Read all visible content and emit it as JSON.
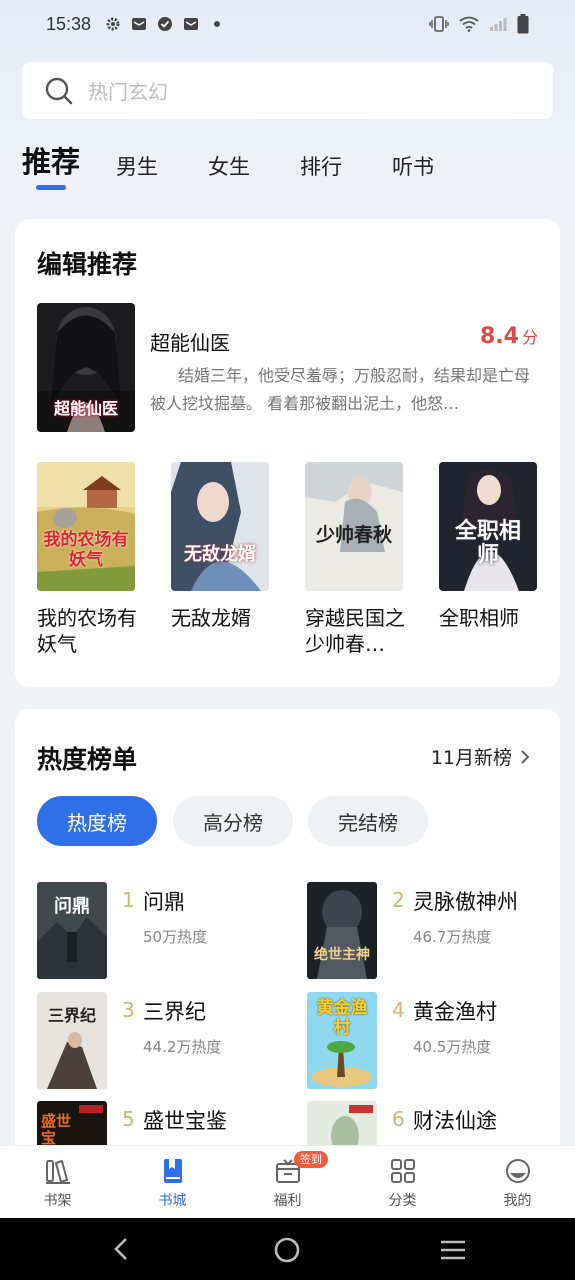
{
  "status_bar": {
    "time": "15:38"
  },
  "search": {
    "placeholder": "热门玄幻"
  },
  "tabs": [
    {
      "label": "推荐",
      "active": true
    },
    {
      "label": "男生"
    },
    {
      "label": "女生"
    },
    {
      "label": "排行"
    },
    {
      "label": "听书"
    }
  ],
  "editor_pick": {
    "title": "编辑推荐",
    "featured": {
      "title": "超能仙医",
      "score": "8.4",
      "score_unit": "分",
      "description": "结婚三年，他受尽羞辱；万般忍耐，结果却是亡母被人挖坟掘墓。 看着那被翻出泥土，他怒…",
      "cover_text": "超能仙医"
    },
    "books": [
      {
        "title": "我的农场有妖气",
        "cover_text": "我的农场有妖气"
      },
      {
        "title": "无敌龙婿",
        "cover_text": "无敌龙婿"
      },
      {
        "title": "穿越民国之少帅春…",
        "cover_text": "少帅春秋"
      },
      {
        "title": "全职相师",
        "cover_text": "全职相师"
      }
    ]
  },
  "hot_list": {
    "title": "热度榜单",
    "more_label": "11月新榜",
    "filters": [
      {
        "label": "热度榜",
        "active": true
      },
      {
        "label": "高分榜"
      },
      {
        "label": "完结榜"
      }
    ],
    "items": [
      {
        "rank": "1",
        "title": "问鼎",
        "heat": "50万热度",
        "cover_text": "问鼎"
      },
      {
        "rank": "2",
        "title": "灵脉傲神州",
        "heat": "46.7万热度",
        "cover_text": "绝世主神"
      },
      {
        "rank": "3",
        "title": "三界纪",
        "heat": "44.2万热度",
        "cover_text": "三界纪"
      },
      {
        "rank": "4",
        "title": "黄金渔村",
        "heat": "40.5万热度",
        "cover_text": "黄金渔村"
      },
      {
        "rank": "5",
        "title": "盛世宝鉴",
        "heat": "",
        "cover_text": "盛世宝"
      },
      {
        "rank": "6",
        "title": "财法仙途",
        "heat": "",
        "cover_text": ""
      }
    ]
  },
  "bottom_nav": [
    {
      "label": "书架",
      "icon": "bookshelf-icon"
    },
    {
      "label": "书城",
      "icon": "bookstore-icon",
      "active": true
    },
    {
      "label": "福利",
      "icon": "gift-icon",
      "badge": "签到"
    },
    {
      "label": "分类",
      "icon": "category-icon"
    },
    {
      "label": "我的",
      "icon": "profile-icon"
    }
  ],
  "colors": {
    "accent": "#2f6fe8",
    "score": "#e04848",
    "rank": "#d6b370",
    "badge": "#f25b3d"
  }
}
